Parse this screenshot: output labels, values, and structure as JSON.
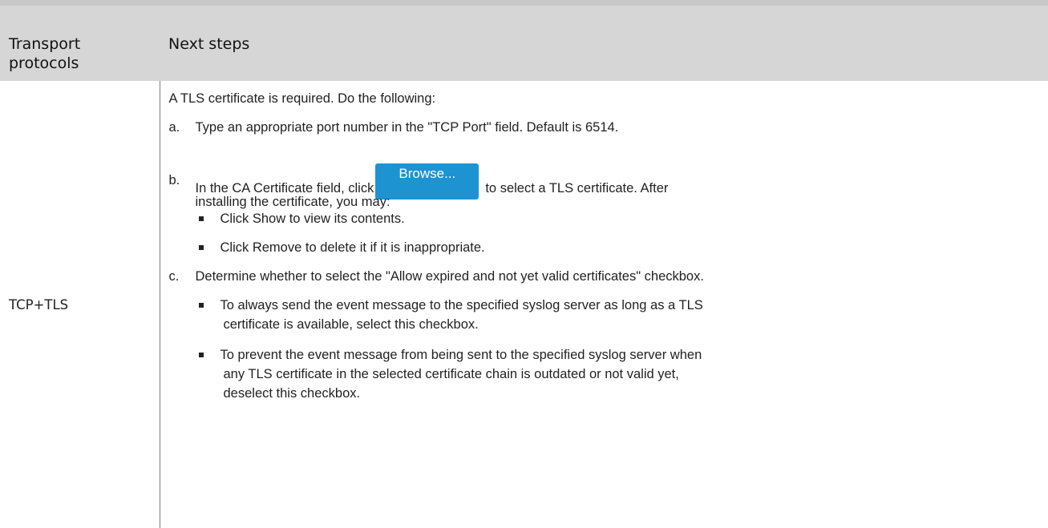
{
  "table": {
    "headers": [
      "Transport protocols",
      "Next steps"
    ],
    "header_line1": "Transport",
    "header_line2": "protocols",
    "protocol": "TCP+TLS",
    "intro": "A TLS certificate is required. Do the following:",
    "step_a": {
      "marker": "a.",
      "text": "Type an appropriate port number in the \"TCP Port\" field. Default is 6514."
    },
    "step_b": {
      "marker": "b.",
      "text_before": "In the CA Certificate field, click",
      "button_label": "Browse...",
      "text_after": "to select a TLS certificate. After",
      "text_line2": "installing the certificate, you may:",
      "bullets": [
        "Click Show to view its contents.",
        "Click Remove to delete it if it is inappropriate."
      ]
    },
    "step_c": {
      "marker": "c.",
      "text": "Determine whether to select the \"Allow expired and not yet valid certificates\" checkbox.",
      "bullets": [
        {
          "line1": "To always send the event message to the specified syslog server as long as a TLS",
          "line2": "certificate is available, select this checkbox."
        },
        {
          "line1": "To prevent the event message from being sent to the specified syslog server when",
          "line2": "any TLS certificate in the selected certificate chain is outdated or not valid yet,",
          "line3": "deselect this checkbox."
        }
      ]
    }
  }
}
